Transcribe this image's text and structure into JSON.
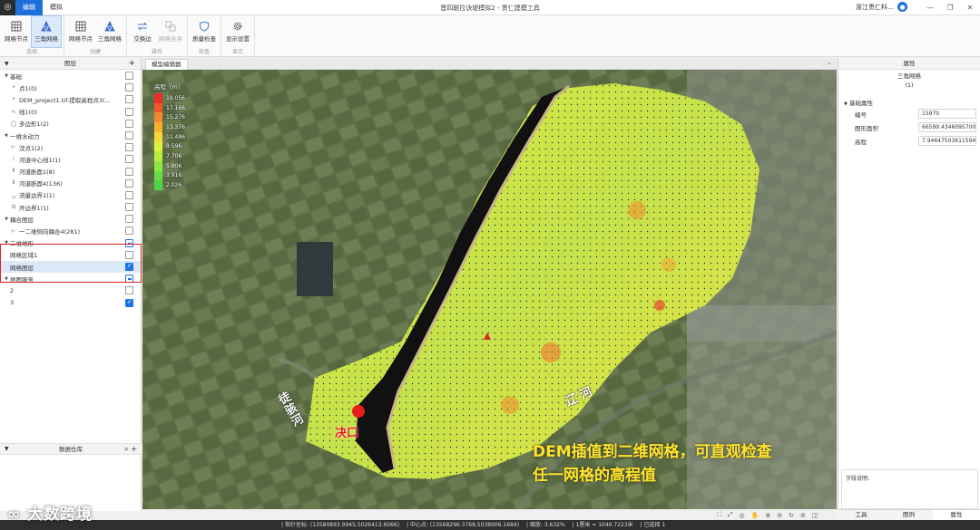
{
  "app": {
    "title": "晋四联拉诀堤模拟2 - 贵仁建模工具",
    "menu_tabs": [
      "编辑",
      "模拟"
    ],
    "user": "浙江贵仁科…"
  },
  "ribbon": {
    "groups": [
      {
        "label": "选择",
        "buttons": [
          {
            "label": "网格节点",
            "icon": "grid-node-icon"
          },
          {
            "label": "三角网格",
            "icon": "triangle-grid-icon",
            "active": true
          }
        ]
      },
      {
        "label": "创建",
        "buttons": [
          {
            "label": "网格节点",
            "icon": "grid-node-icon"
          },
          {
            "label": "三角网格",
            "icon": "triangle-grid-icon"
          }
        ]
      },
      {
        "label": "操作",
        "buttons": [
          {
            "label": "交换边",
            "icon": "swap-edge-icon"
          },
          {
            "label": "网格合并",
            "icon": "merge-grid-icon",
            "disabled": true
          }
        ]
      },
      {
        "label": "检查",
        "buttons": [
          {
            "label": "质量检查",
            "icon": "shield-check-icon"
          }
        ]
      },
      {
        "label": "显示",
        "buttons": [
          {
            "label": "显示设置",
            "icon": "gear-icon"
          }
        ]
      }
    ]
  },
  "layers_panel": {
    "title": "图层",
    "items": [
      {
        "label": "基础",
        "level": 0,
        "expanded": true,
        "check": "off"
      },
      {
        "label": "点1(0)",
        "level": 1,
        "icon": "•",
        "check": "off"
      },
      {
        "label": "DEM_project1.tif-提取高程点3(...",
        "level": 1,
        "icon": "•",
        "check": "off"
      },
      {
        "label": "线1(0)",
        "level": 1,
        "icon": "∿",
        "check": "off"
      },
      {
        "label": "多边形1(2)",
        "level": 1,
        "icon": "◯",
        "check": "off"
      },
      {
        "label": "一维水动力",
        "level": 0,
        "expanded": true,
        "check": "off"
      },
      {
        "label": "汊点1(2)",
        "level": 1,
        "icon": "⊢",
        "check": "off"
      },
      {
        "label": "河道中心线1(1)",
        "level": 1,
        "icon": "⁞",
        "check": "off"
      },
      {
        "label": "河道断面1(8)",
        "level": 1,
        "icon": "⫴",
        "check": "off"
      },
      {
        "label": "河道断面4(136)",
        "level": 1,
        "icon": "⫴",
        "check": "off"
      },
      {
        "label": "流量边界1(1)",
        "level": 1,
        "icon": "⍽",
        "check": "off"
      },
      {
        "label": "开边界1(1)",
        "level": 1,
        "icon": "⊡",
        "check": "off"
      },
      {
        "label": "耦合图层",
        "level": 0,
        "expanded": true,
        "check": "off"
      },
      {
        "label": "一二维侧向耦合4(281)",
        "level": 1,
        "icon": "⊢",
        "check": "off"
      },
      {
        "label": "二维地形",
        "level": 0,
        "expanded": true,
        "check": "part"
      },
      {
        "label": "网格区域1",
        "level": 1,
        "icon": "",
        "check": "off"
      },
      {
        "label": "网格图层",
        "level": 1,
        "icon": "",
        "check": "on",
        "selected": true
      },
      {
        "label": "地图服务",
        "level": 0,
        "expanded": true,
        "check": "part"
      },
      {
        "label": "2",
        "level": 1,
        "icon": "",
        "check": "off"
      },
      {
        "label": "3",
        "level": 1,
        "icon": "",
        "check": "on"
      }
    ]
  },
  "data_panel": {
    "title": "数据仓库"
  },
  "editor": {
    "tab_label": "模型编辑器"
  },
  "legend": {
    "title": "高程（m）",
    "labels": [
      "19.056",
      "17.166",
      "15.276",
      "13.376",
      "11.486",
      "9.596",
      "7.706",
      "5.806",
      "3.916",
      "2.026"
    ],
    "colors": [
      "#e8302a",
      "#ef5a2c",
      "#f4882e",
      "#f7b230",
      "#f4d836",
      "#dff03a",
      "#b9ec3c",
      "#8de540",
      "#69dc44",
      "#4fd447"
    ]
  },
  "map_labels": {
    "river_left": "徒骇河",
    "river_right": "辽 河",
    "breach": "决口",
    "caption_line1": "DEM插值到二维网格，可直观检查",
    "caption_line2": "任一网格的高程值",
    "watermark": "大数跨境"
  },
  "properties": {
    "title": "属性",
    "object_name": "三角网格",
    "object_count": "(1)",
    "section": "基础属性",
    "rows": [
      {
        "key": "编号",
        "value": "15970"
      },
      {
        "key": "图形面积",
        "value": "66599.4346095700"
      },
      {
        "key": "高程",
        "value": "7.94647503611594"
      }
    ],
    "description_label": "字段说明:"
  },
  "bottom_tabs": [
    "工具",
    "图例",
    "属性"
  ],
  "status": {
    "cursor": "| 指针坐标: (13580893.9945,5026413.6066)",
    "center": "| 中心点: (13568296.3768,5038006.1684)",
    "zoom": "| 缩放: 3.632%",
    "scale": "| 1厘米 = 1040.7223米",
    "selected": "| 已选择 1"
  }
}
